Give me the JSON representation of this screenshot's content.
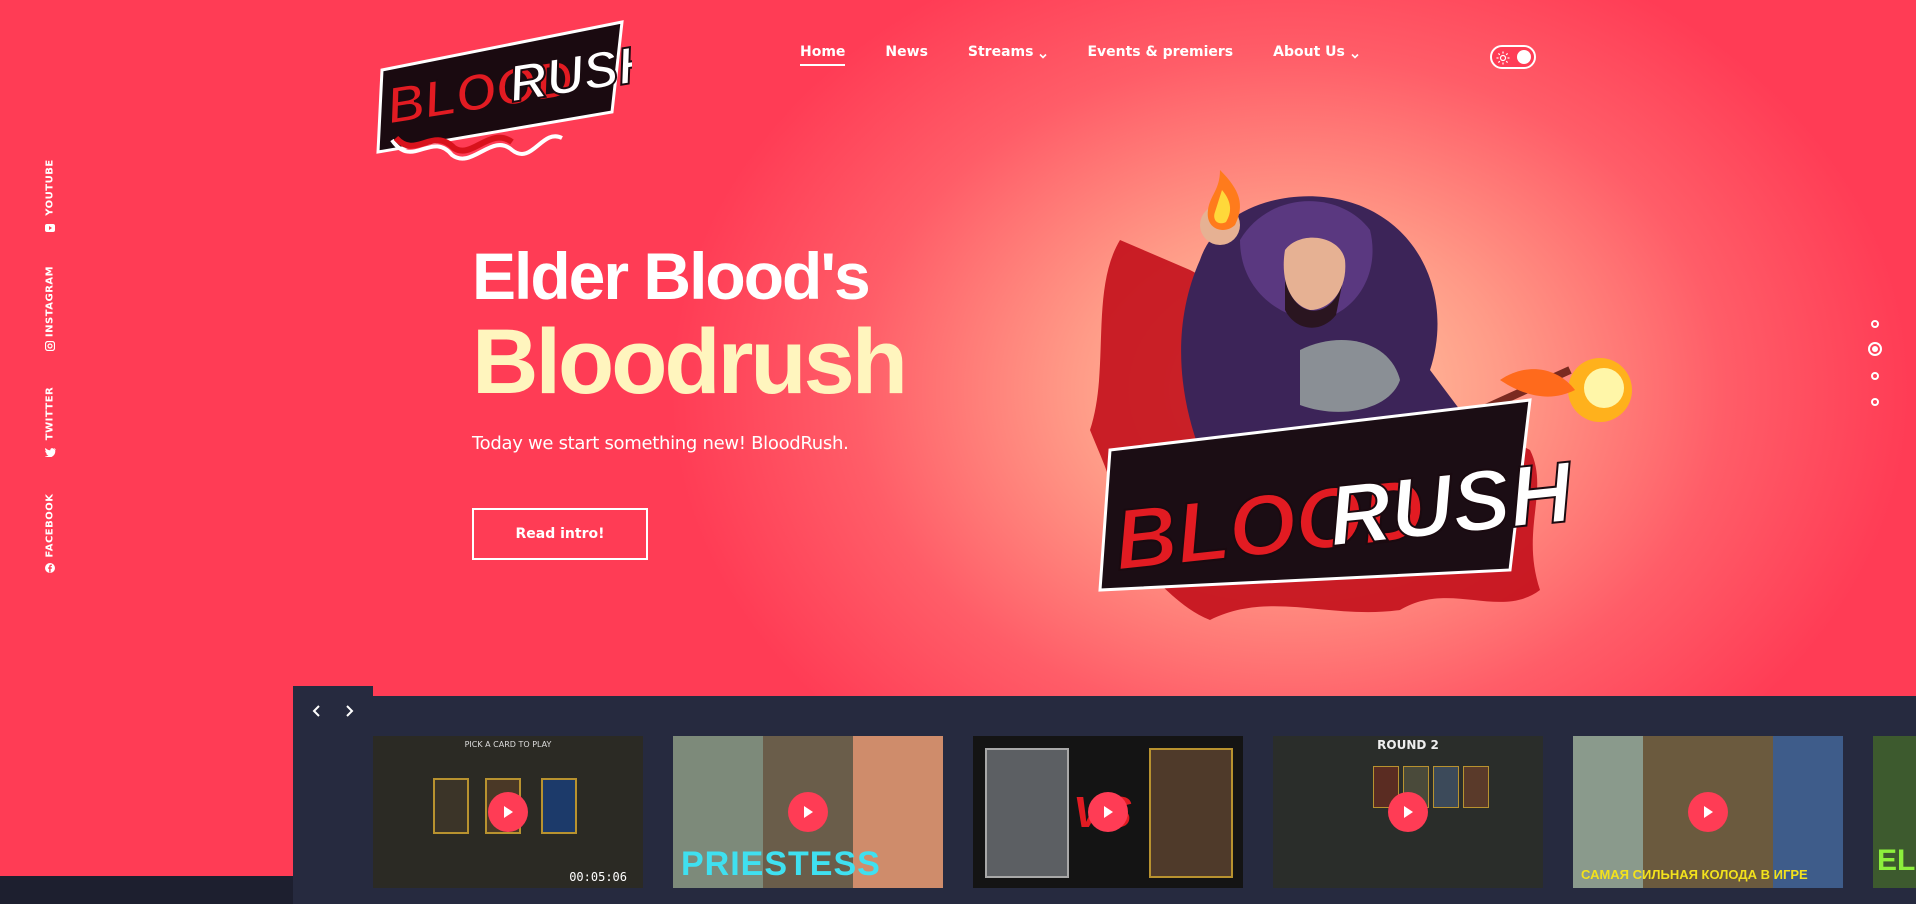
{
  "social": [
    {
      "label": "YOUTUBE",
      "icon": "youtube-icon"
    },
    {
      "label": "INSTAGRAM",
      "icon": "instagram-icon"
    },
    {
      "label": "TWITTER",
      "icon": "twitter-icon"
    },
    {
      "label": "FACEBOOK",
      "icon": "facebook-icon"
    }
  ],
  "logo": {
    "text_red": "BLOOD",
    "text_white": "RUSH"
  },
  "nav": {
    "items": [
      {
        "label": "Home",
        "active": true,
        "dropdown": false
      },
      {
        "label": "News",
        "active": false,
        "dropdown": false
      },
      {
        "label": "Streams",
        "active": false,
        "dropdown": true
      },
      {
        "label": "Events & premiers",
        "active": false,
        "dropdown": false
      },
      {
        "label": "About Us",
        "active": false,
        "dropdown": true
      }
    ]
  },
  "theme_toggle": {
    "state": "light",
    "icon": "sun-icon"
  },
  "hero": {
    "title_line1": "Elder Blood's",
    "title_line2": "Bloodrush",
    "subtitle": "Today we start something new! BloodRush.",
    "button_label": "Read intro!"
  },
  "mascot": {
    "text_red": "BLOOD",
    "text_white": "RUSH"
  },
  "slider_dots": {
    "count": 4,
    "active_index": 1
  },
  "videos": [
    {
      "top_caption": "PICK A CARD TO PLAY",
      "caption": "",
      "duration": "00:05:06",
      "bg": "#2b2a24"
    },
    {
      "top_caption": "",
      "caption": "PRIESTESS",
      "duration": "",
      "bg": "#5a6a58"
    },
    {
      "top_caption": "",
      "caption": "VS",
      "duration": "",
      "bg": "#141414"
    },
    {
      "top_caption": "",
      "caption": "ROUND 2",
      "duration": "",
      "bg": "#2a2d2a"
    },
    {
      "top_caption": "",
      "caption": "САМАЯ СИЛЬНАЯ КОЛОДА В ИГРЕ",
      "duration": "",
      "bg": "#6b5a3e"
    },
    {
      "top_caption": "",
      "caption": "EL",
      "duration": "",
      "bg": "#3d5a2e"
    }
  ],
  "colors": {
    "accent": "#ff3c55",
    "dark_strip": "#262a3f",
    "hero_title_highlight": "#fff5be"
  }
}
